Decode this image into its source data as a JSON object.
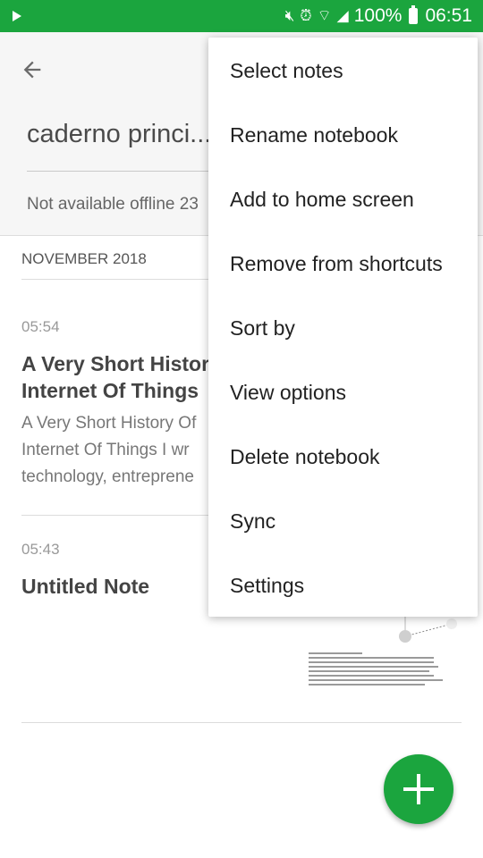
{
  "status_bar": {
    "battery": "100%",
    "time": "06:51",
    "icons": [
      "play-icon",
      "mute-icon",
      "alarm-icon",
      "wifi-icon",
      "signal-icon",
      "battery-icon"
    ]
  },
  "header": {
    "title": "caderno princi...",
    "offline_status": "Not available offline 23"
  },
  "notes": {
    "section_label": "NOVEMBER 2018",
    "items": [
      {
        "time": "05:54",
        "title_line1": "A Very Short History",
        "title_line2": "Internet Of Things",
        "snippet_line1": "A Very Short History Of",
        "snippet_line2": "Internet Of Things I wr",
        "snippet_line3": "technology, entreprene"
      },
      {
        "time": "05:43",
        "title_line1": "Untitled Note"
      }
    ]
  },
  "menu": {
    "items": [
      "Select notes",
      "Rename notebook",
      "Add to home screen",
      "Remove from shortcuts",
      "Sort by",
      "View options",
      "Delete notebook",
      "Sync",
      "Settings"
    ]
  },
  "colors": {
    "brand": "#1ba53e",
    "header_bg": "#f6f6f6"
  }
}
